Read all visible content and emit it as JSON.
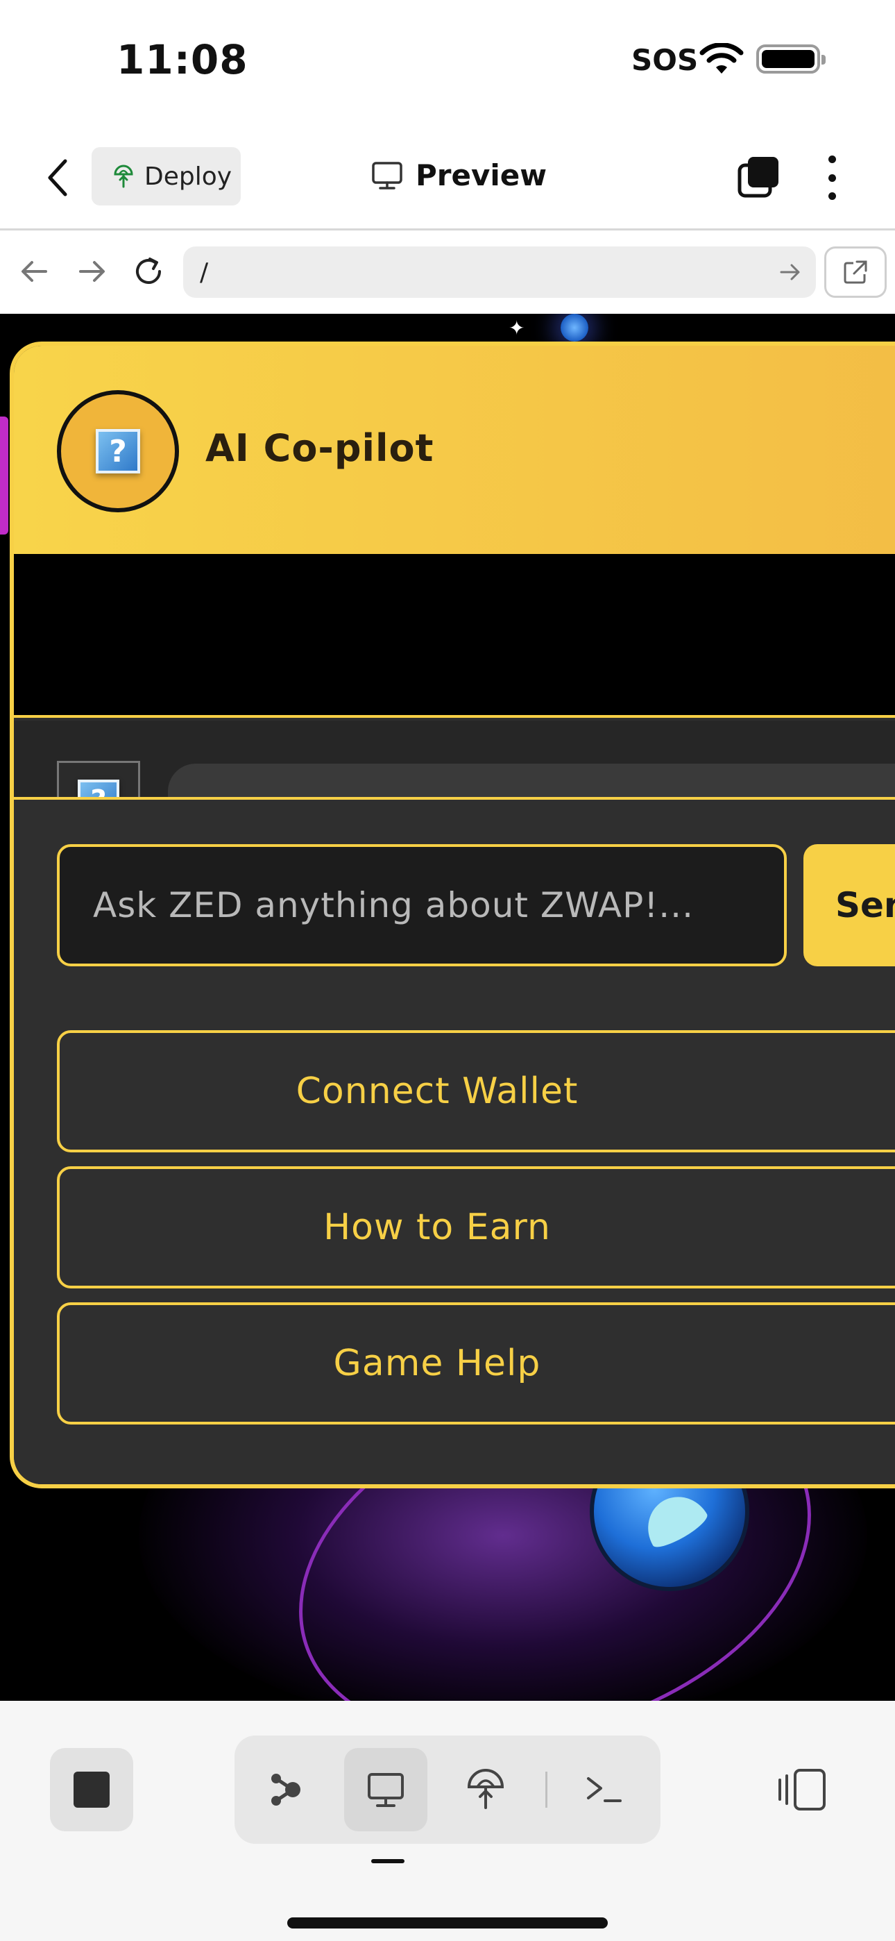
{
  "status_bar": {
    "time": "11:08",
    "signal_text": "SOS"
  },
  "header": {
    "deploy_label": "Deploy",
    "title": "Preview"
  },
  "browser": {
    "url": "/"
  },
  "chat": {
    "title": "AI Co-pilot",
    "input_placeholder": "Ask ZED anything about ZWAP!...",
    "send_label": "Send",
    "quick_actions": [
      {
        "label": "Connect Wallet"
      },
      {
        "label": "How to Earn"
      },
      {
        "label": "Game Help"
      }
    ],
    "avatar_glyph": "?"
  },
  "colors": {
    "accent": "#f7d046",
    "panel_bg": "#2f2f2f",
    "viewport_bg": "#000000"
  }
}
